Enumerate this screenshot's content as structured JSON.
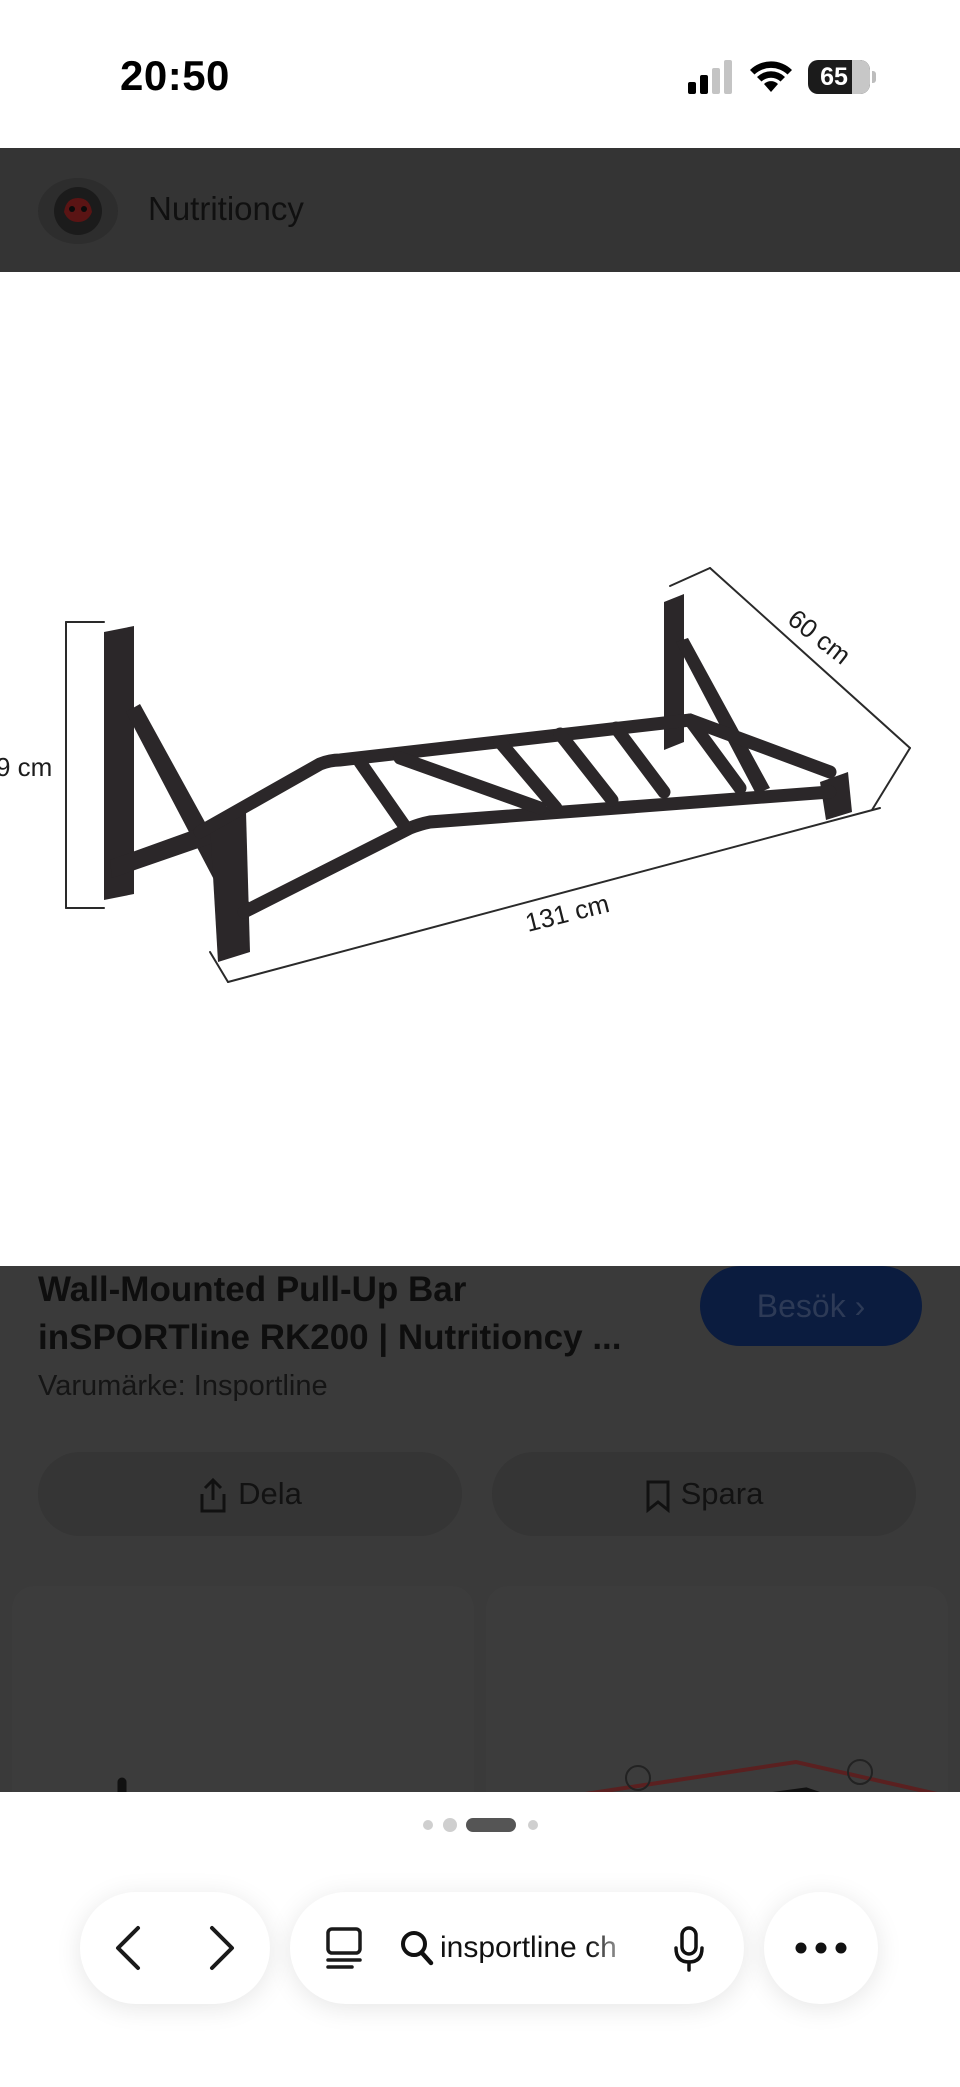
{
  "status_bar": {
    "time": "20:50",
    "battery": "65",
    "icons": [
      "cellular-signal-icon",
      "wifi-icon",
      "battery-icon"
    ]
  },
  "site": {
    "name": "Nutritioncy",
    "logo_icon": "nutritioncy-logo"
  },
  "image": {
    "dimension_height": "9 cm",
    "dimension_depth": "60 cm",
    "dimension_width": "131 cm"
  },
  "product": {
    "title": "Wall-Mounted Pull-Up Bar inSPORTline RK200 | Nutritioncy ...",
    "visit_label": "Besök",
    "brand": "Varumärke: Insportline",
    "share_label": "Dela",
    "save_label": "Spara"
  },
  "carousel": {
    "total_dots": 4,
    "active_index": 2
  },
  "browser": {
    "search_text": "insportline ch",
    "icons": [
      "back-icon",
      "forward-icon",
      "tabs-icon",
      "search-icon",
      "mic-icon",
      "more-icon"
    ]
  },
  "colors": {
    "overlay_dark": "#3a3a3a",
    "visit_button": "#0b1c3f",
    "status_text": "#000000"
  }
}
